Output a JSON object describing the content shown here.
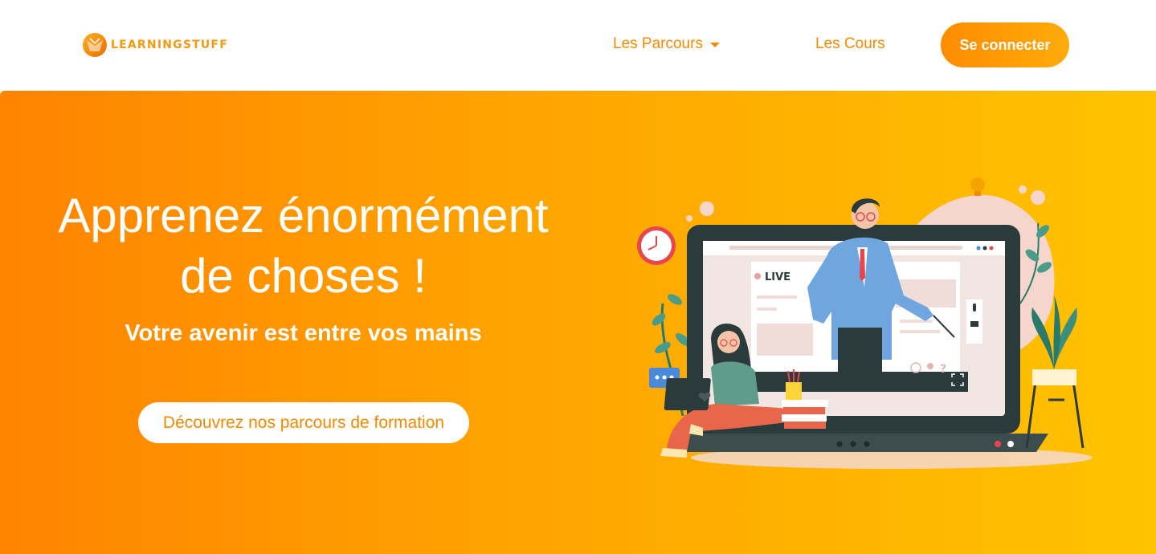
{
  "header": {
    "logo_text": "LEARNINGSTUFF",
    "nav": {
      "parcours_label": "Les Parcours",
      "cours_label": "Les Cours"
    },
    "connect_label": "Se connecter"
  },
  "hero": {
    "title_line1": "Apprenez énormément",
    "title_line2": "de choses !",
    "subtitle": "Votre avenir est entre vos mains",
    "cta_label": "Découvrez nos parcours de formation",
    "illustration": {
      "live_label": "LIVE"
    }
  },
  "colors": {
    "brand_orange": "#f28a00",
    "gradient_start": "#ff8400",
    "gradient_end": "#ffc300",
    "white": "#ffffff"
  },
  "icons": [
    "chevron-down-icon",
    "lightbulb-icon",
    "clock-icon",
    "chat-icon",
    "globe-icon",
    "location-icon",
    "question-icon",
    "fullscreen-icon",
    "microphone-icon",
    "camera-icon",
    "heart-icon"
  ]
}
